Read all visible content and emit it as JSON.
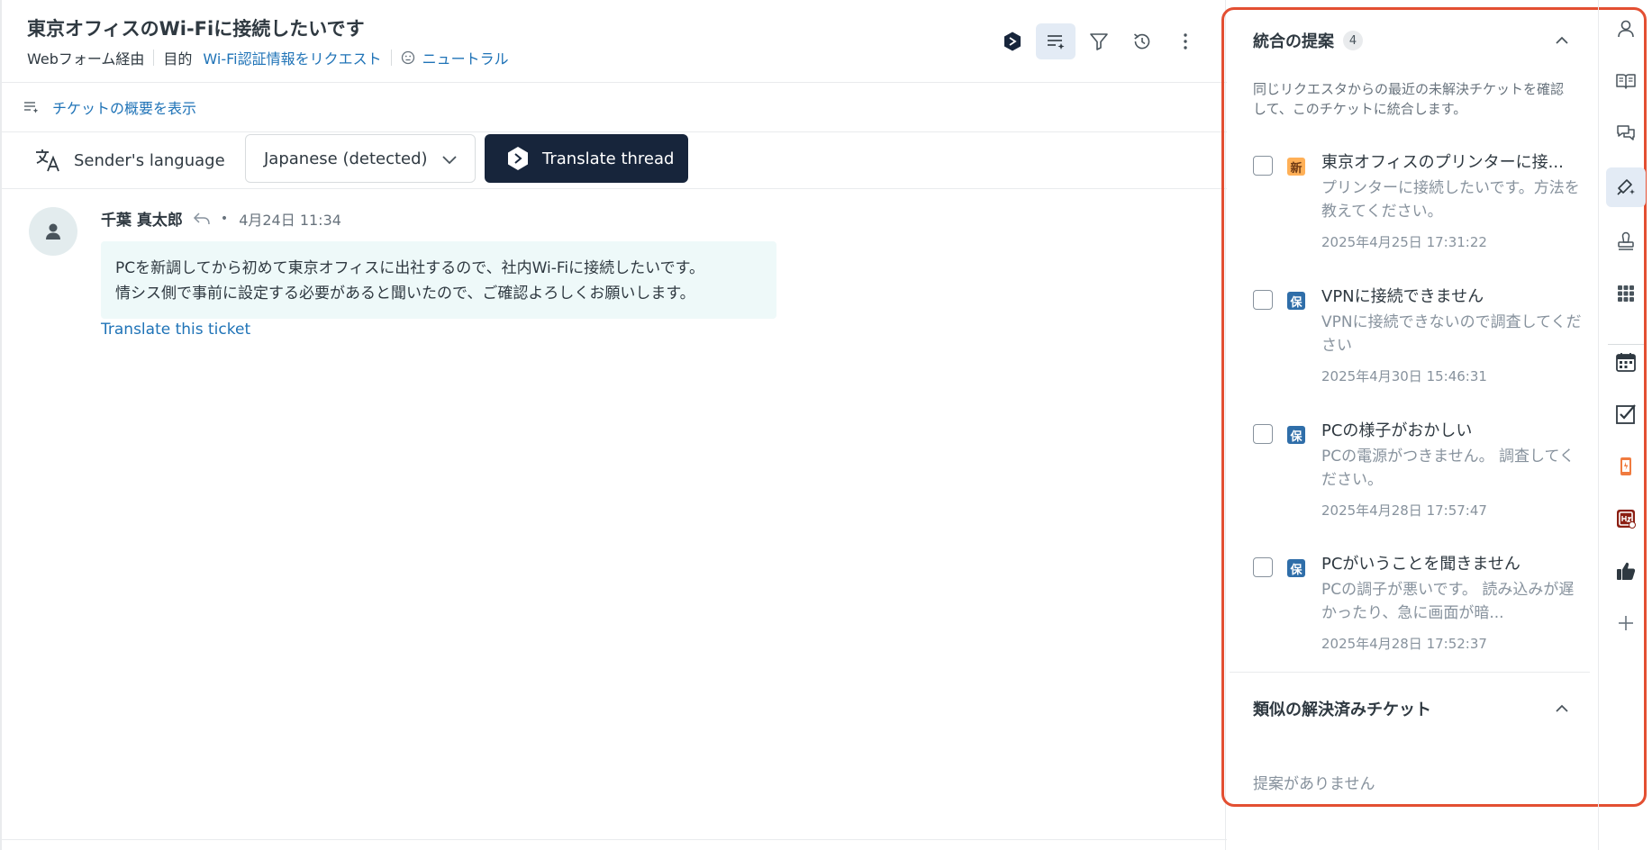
{
  "ticket": {
    "title": "東京オフィスのWi-Fiに接続したいです",
    "channel": "Webフォーム経由",
    "purpose_label": "目的",
    "purpose_value": "Wi-Fi認証情報をリクエスト",
    "sentiment": "ニュートラル"
  },
  "toolbar": {
    "icons": [
      "copilot-icon",
      "ticket-summary-icon",
      "filter-icon",
      "history-icon",
      "more-options-icon"
    ]
  },
  "summary": {
    "label": "チケットの概要を表示"
  },
  "translation": {
    "sender_language_label": "Sender's language",
    "selected_language": "Japanese (detected)",
    "translate_button": "Translate thread"
  },
  "message": {
    "sender": "千葉 真太郎",
    "separator": "•",
    "timestamp": "4月24日 11:34",
    "body_line1": "PCを新調してから初めて東京オフィスに出社するので、社内Wi-Fiに接続したいです。",
    "body_line2": "情シス側で事前に設定する必要があると聞いたので、ご確認よろしくお願いします。",
    "translate_link": "Translate this ticket"
  },
  "merge_panel": {
    "title": "統合の提案",
    "count": "4",
    "description": "同じリクエスタからの最近の未解決チケットを確認して、このチケットに統合します。",
    "suggestions": [
      {
        "status": "新",
        "status_type": "new",
        "title": "東京オフィスのプリンターに接...",
        "body": "プリンターに接続したいです。方法を教えてください。",
        "date": "2025年4月25日 17:31:22"
      },
      {
        "status": "保",
        "status_type": "hold",
        "title": "VPNに接続できません",
        "body": "VPNに接続できないので調査してください",
        "date": "2025年4月30日 15:46:31"
      },
      {
        "status": "保",
        "status_type": "hold",
        "title": "PCの様子がおかしい",
        "body": "PCの電源がつきません。 調査してください。",
        "date": "2025年4月28日 17:57:47"
      },
      {
        "status": "保",
        "status_type": "hold",
        "title": "PCがいうことを聞きません",
        "body": "PCの調子が悪いです。 読み込みが遅かったり、急に画面が暗...",
        "date": "2025年4月28日 17:52:37"
      }
    ]
  },
  "similar_panel": {
    "title": "類似の解決済みチケット",
    "empty_text": "提案がありません"
  },
  "rail": {
    "icons": [
      "user-icon",
      "knowledge-icon",
      "conversations-icon",
      "intelligence-icon",
      "stamp-icon",
      "apps-grid-icon",
      "calendar-icon",
      "checklist-icon",
      "mobile-app-icon",
      "app-logo-icon",
      "thumbs-up-icon",
      "add-icon"
    ]
  },
  "colors": {
    "accent": "#1f73b7",
    "dark_button": "#17253b",
    "highlight_frame": "#e34f32",
    "badge_new": "#ffb057",
    "badge_hold": "#2f6ea9",
    "message_bg": "#eef9f9"
  }
}
